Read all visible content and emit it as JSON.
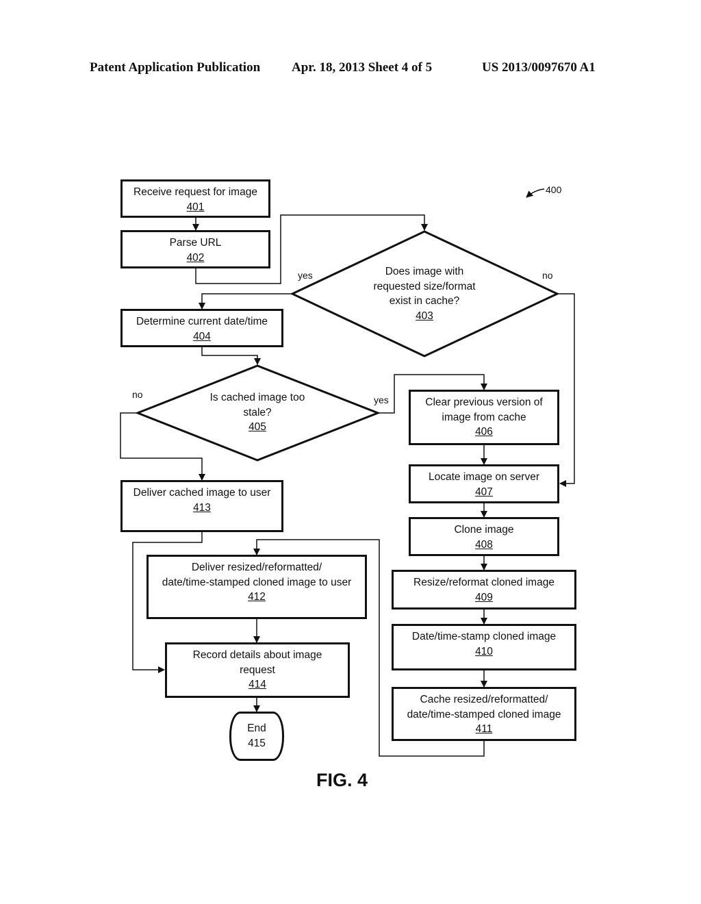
{
  "header": {
    "publication": "Patent Application Publication",
    "date_sheet": "Apr. 18, 2013  Sheet 4 of 5",
    "number": "US 2013/0097670 A1"
  },
  "figure": {
    "reference": "400",
    "caption": "FIG. 4"
  },
  "nodes": {
    "n401": {
      "text": "Receive request for image",
      "num": "401"
    },
    "n402": {
      "text": "Parse URL",
      "num": "402"
    },
    "n403": {
      "line1": "Does image with",
      "line2": "requested size/format",
      "line3": "exist in cache?",
      "num": "403"
    },
    "n404": {
      "text": "Determine current date/time",
      "num": "404"
    },
    "n405": {
      "line1": "Is cached image too",
      "line2": "stale?",
      "num": "405"
    },
    "n406": {
      "line1": "Clear previous version of",
      "line2": "image from cache",
      "num": "406"
    },
    "n407": {
      "text": "Locate image on server",
      "num": "407"
    },
    "n408": {
      "text": "Clone image",
      "num": "408"
    },
    "n409": {
      "text": "Resize/reformat cloned image",
      "num": "409"
    },
    "n410": {
      "text": "Date/time-stamp cloned image",
      "num": "410"
    },
    "n411": {
      "line1": "Cache resized/reformatted/",
      "line2": "date/time-stamped cloned image",
      "num": "411"
    },
    "n412": {
      "line1": "Deliver resized/reformatted/",
      "line2": "date/time-stamped cloned image to user",
      "num": "412"
    },
    "n413": {
      "text": "Deliver cached image to user",
      "num": "413"
    },
    "n414": {
      "line1": "Record details about image",
      "line2": "request",
      "num": "414"
    },
    "n415": {
      "text": "End",
      "num": "415"
    }
  },
  "edge_labels": {
    "d403_yes": "yes",
    "d403_no": "no",
    "d405_no": "no",
    "d405_yes": "yes"
  }
}
